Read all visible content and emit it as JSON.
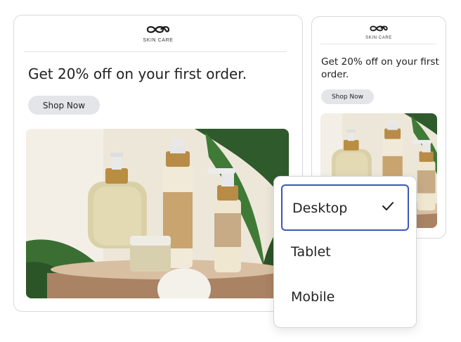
{
  "brand": {
    "logo_text": "SKIN CARE"
  },
  "desktop_preview": {
    "headline": "Get 20% off on your first order.",
    "button_label": "Shop Now"
  },
  "mobile_preview": {
    "headline": "Get 20% off on your first order.",
    "button_label": "Shop Now"
  },
  "device_menu": {
    "options": [
      {
        "label": "Desktop",
        "selected": true
      },
      {
        "label": "Tablet",
        "selected": false
      },
      {
        "label": "Mobile",
        "selected": false
      }
    ],
    "selected_icon": "checkmark-icon"
  },
  "colors": {
    "selection_border": "#3c57b8",
    "button_bg": "#e4e5e9",
    "card_border": "#d9d9de"
  }
}
